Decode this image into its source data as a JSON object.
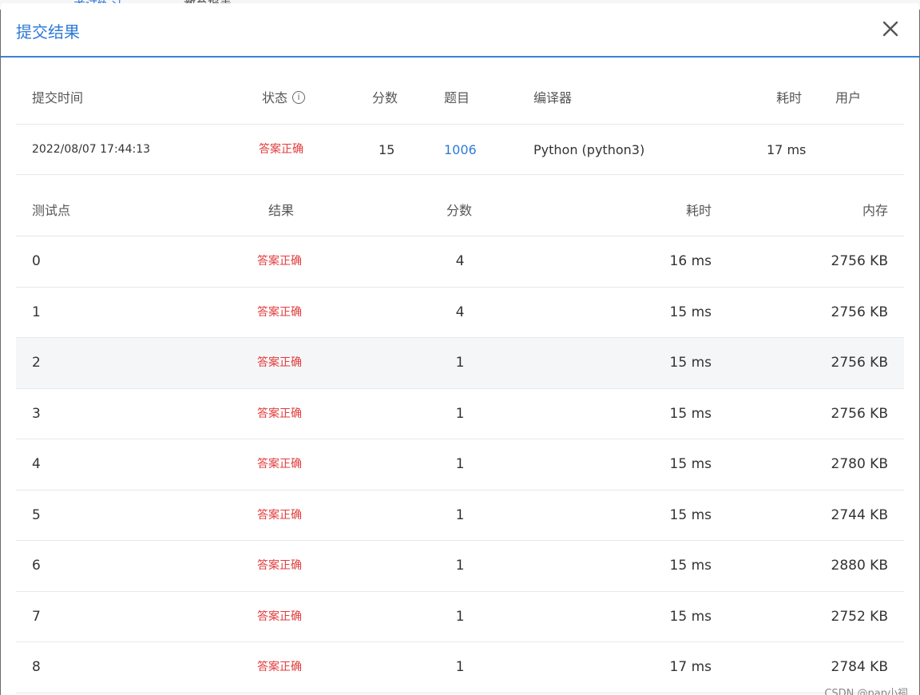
{
  "background_tabs": [
    "",
    "考试练习",
    "教育报表"
  ],
  "modal": {
    "title": "提交结果",
    "close_icon": "close-icon"
  },
  "summary": {
    "headers": {
      "submit_time": "提交时间",
      "status": "状态",
      "score": "分数",
      "problem": "题目",
      "compiler": "编译器",
      "time": "耗时",
      "user": "用户"
    },
    "row": {
      "submit_time": "2022/08/07 17:44:13",
      "status": "答案正确",
      "score": "15",
      "problem": "1006",
      "compiler": "Python (python3)",
      "time": "17 ms",
      "user": ""
    }
  },
  "detail": {
    "headers": {
      "case": "测试点",
      "result": "结果",
      "score": "分数",
      "time": "耗时",
      "memory": "内存"
    },
    "rows": [
      {
        "case": "0",
        "result": "答案正确",
        "score": "4",
        "time": "16 ms",
        "memory": "2756 KB"
      },
      {
        "case": "1",
        "result": "答案正确",
        "score": "4",
        "time": "15 ms",
        "memory": "2756 KB"
      },
      {
        "case": "2",
        "result": "答案正确",
        "score": "1",
        "time": "15 ms",
        "memory": "2756 KB"
      },
      {
        "case": "3",
        "result": "答案正确",
        "score": "1",
        "time": "15 ms",
        "memory": "2756 KB"
      },
      {
        "case": "4",
        "result": "答案正确",
        "score": "1",
        "time": "15 ms",
        "memory": "2780 KB"
      },
      {
        "case": "5",
        "result": "答案正确",
        "score": "1",
        "time": "15 ms",
        "memory": "2744 KB"
      },
      {
        "case": "6",
        "result": "答案正确",
        "score": "1",
        "time": "15 ms",
        "memory": "2880 KB"
      },
      {
        "case": "7",
        "result": "答案正确",
        "score": "1",
        "time": "15 ms",
        "memory": "2752 KB"
      },
      {
        "case": "8",
        "result": "答案正确",
        "score": "1",
        "time": "17 ms",
        "memory": "2784 KB"
      }
    ]
  },
  "colors": {
    "accent": "#2f7ad6",
    "status_ok": "#e23b3b",
    "row_hover": "#f5f6f8"
  },
  "watermark": "CSDN @pap小祠"
}
